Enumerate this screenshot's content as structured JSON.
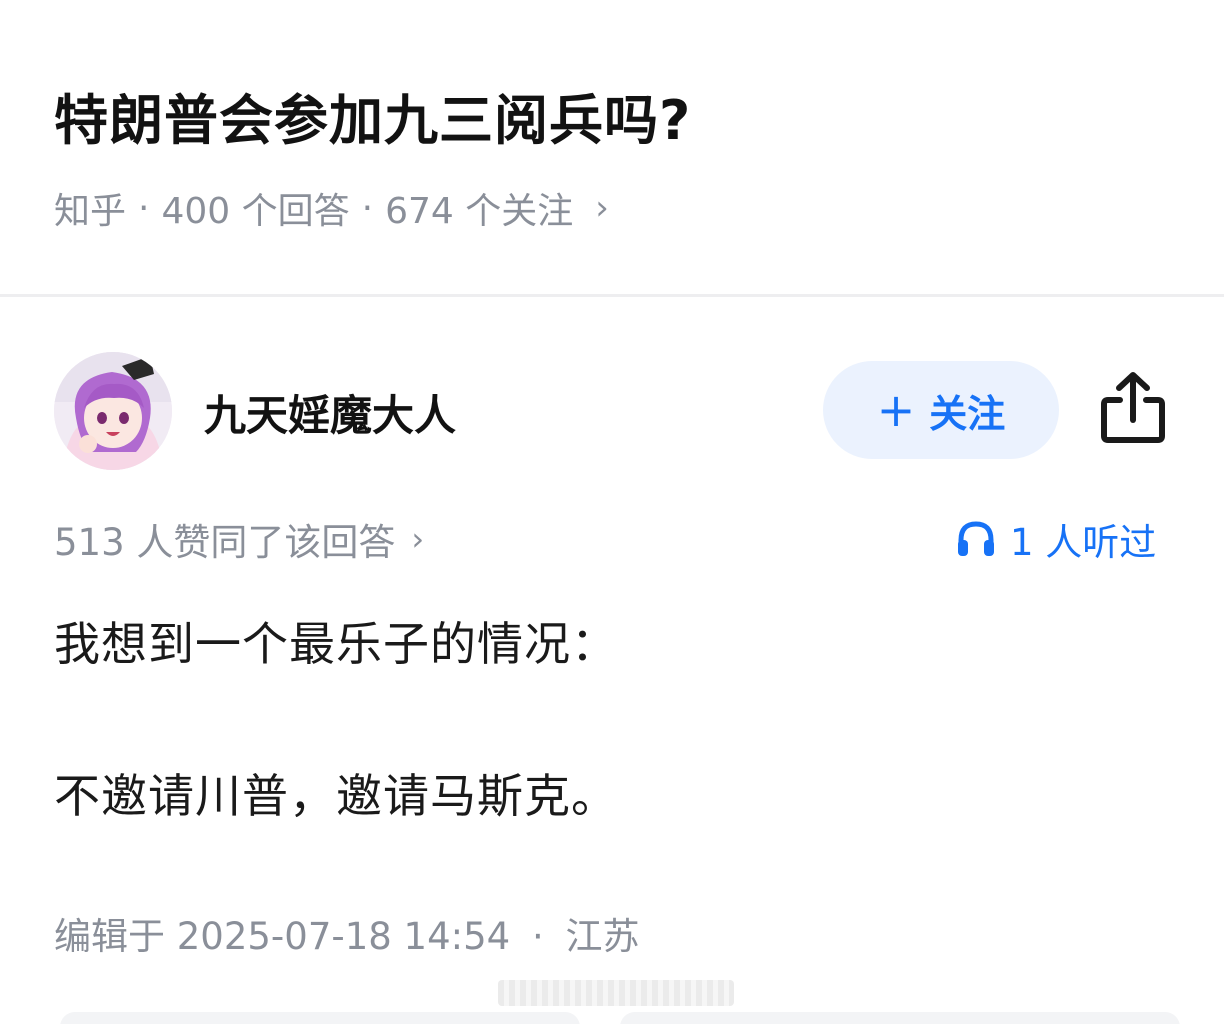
{
  "question": {
    "title": "特朗普会参加九三阅兵吗?",
    "source": "知乎",
    "answers_count": "400 个回答",
    "followers_count": "674 个关注",
    "separator": "·"
  },
  "author": {
    "name": "九天婬魔大人",
    "follow_button_label": "关注",
    "follow_button_icon": "plus-icon",
    "share_icon": "share-icon"
  },
  "answer": {
    "upvote_text": "513 人赞同了该回答",
    "listen_text": "1 人听过",
    "listen_icon": "headphones-icon",
    "paragraphs": [
      "我想到一个最乐子的情况：",
      "不邀请川普，邀请马斯克。"
    ],
    "edit_info": "编辑于 2025-07-18 14:54",
    "location": "江苏"
  },
  "colors": {
    "accent": "#1772f6",
    "follow_bg": "#ebf2fe",
    "meta_gray": "#8a8f99",
    "title": "#121212"
  }
}
